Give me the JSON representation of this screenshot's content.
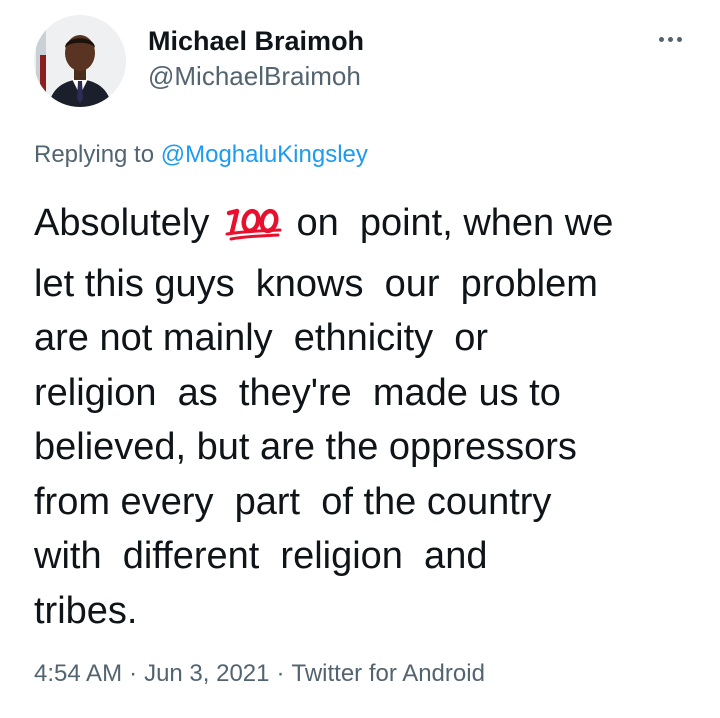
{
  "author": {
    "display_name": "Michael Braimoh",
    "handle": "@MichaelBraimoh",
    "avatar_icon": "profile-photo"
  },
  "more_icon": "more-horizontal-icon",
  "reply": {
    "prefix": "Replying to ",
    "mention": "@MoghaluKingsley"
  },
  "tweet": {
    "emoji": "hundred-points-emoji",
    "line1_before": "Absolutely ",
    "line1_after": " on  point, when we",
    "line2": "let this guys  knows  our  problem",
    "line3": "are not mainly  ethnicity  or",
    "line4": "religion  as  they're  made us to",
    "line5": "believed, but are the oppressors",
    "line6": "from every  part  of the country",
    "line7": "with  different  religion  and",
    "line8": "tribes."
  },
  "meta": {
    "time": "4:54 AM",
    "separator": "·",
    "date": "Jun 3, 2021",
    "source": "Twitter for Android"
  },
  "colors": {
    "text": "#0f1419",
    "secondary": "#536471",
    "link": "#1d9bf0",
    "emoji_red": "#e8112d"
  }
}
